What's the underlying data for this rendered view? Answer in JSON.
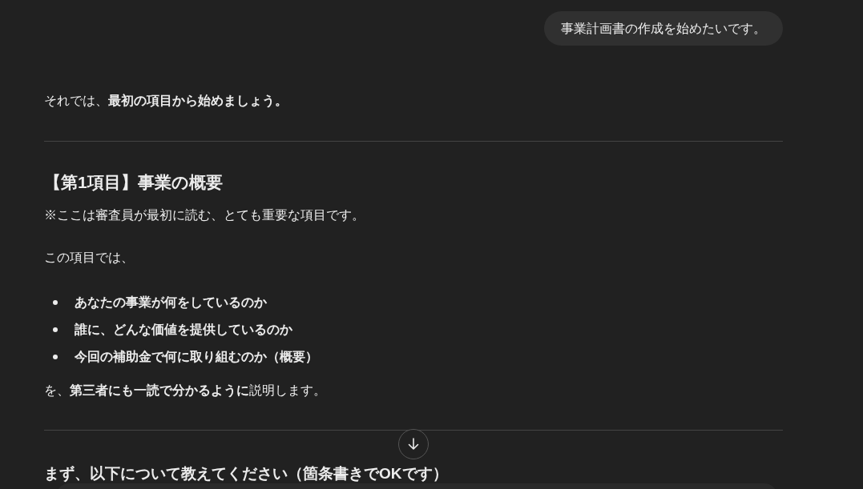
{
  "user_message": "事業計画書の作成を始めたいです。",
  "intro": "それでは、**最初の項目から始めましょう。**",
  "section": {
    "heading": "【第1項目】事業の概要",
    "note": "※ここは審査員が最初に読む、とても重要な項目です。",
    "lead": "この項目では、",
    "bullets": [
      "あなたの事業が何をしているのか",
      "誰に、どんな価値を提供しているのか",
      "今回の補助金で何に取り組むのか（概要）"
    ],
    "closing": "を、**第三者にも一読で分かるように**説明します。"
  },
  "next_heading": "まず、以下について教えてください（箇条書きでOKです）"
}
